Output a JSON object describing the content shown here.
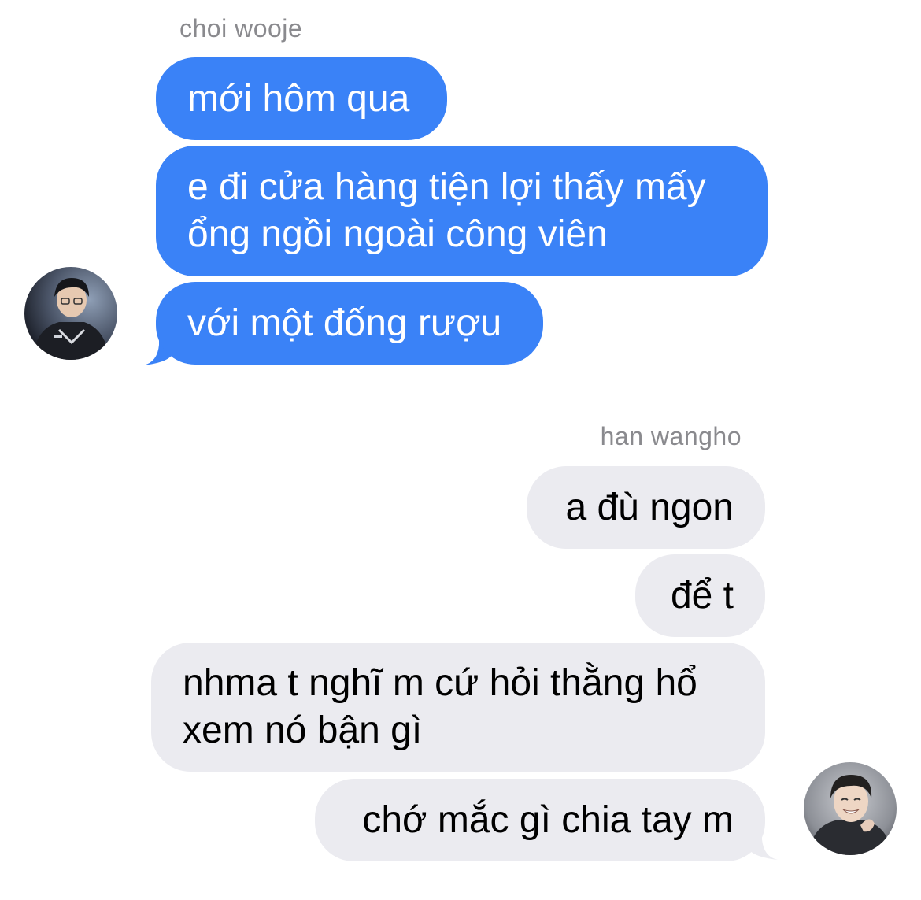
{
  "colors": {
    "incoming_bubble": "#3a82f7",
    "outgoing_bubble": "#ebebf0",
    "sender_name": "#8a8a8e"
  },
  "group_1": {
    "sender": "choi wooje",
    "avatar_icon": "profile-photo-icon",
    "messages": [
      "mới hôm qua",
      "e đi cửa hàng tiện lợi thấy mấy\nổng ngồi ngoài công viên",
      "với một đống rượu"
    ]
  },
  "group_2": {
    "sender": "han wangho",
    "avatar_icon": "profile-photo-icon",
    "messages": [
      "a đù ngon",
      "để t",
      "nhma t nghĩ m cứ hỏi thằng hổ\nxem nó bận gì",
      "chớ mắc gì chia tay m"
    ]
  }
}
